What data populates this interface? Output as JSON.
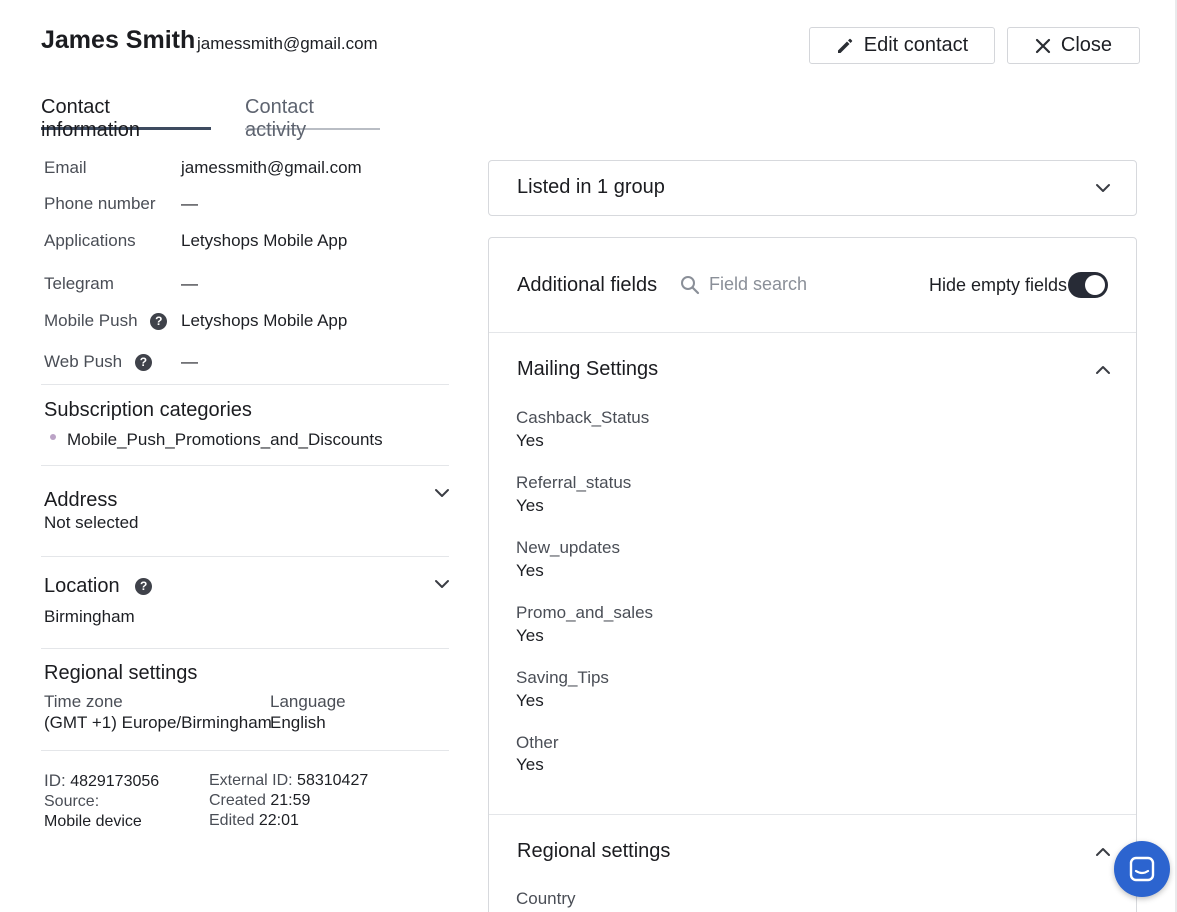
{
  "header": {
    "name": "James Smith",
    "email": "jamessmith@gmail.com",
    "edit_label": "Edit contact",
    "close_label": "Close"
  },
  "tabs": [
    {
      "label": "Contact information",
      "active": true
    },
    {
      "label": "Contact activity",
      "active": false
    }
  ],
  "contact": {
    "email_label": "Email",
    "email_value": "jamessmith@gmail.com",
    "phone_label": "Phone number",
    "phone_value": "—",
    "apps_label": "Applications",
    "apps_value": "Letyshops Mobile App",
    "telegram_label": "Telegram",
    "telegram_value": "—",
    "mobile_push_label": "Mobile Push",
    "mobile_push_value": "Letyshops Mobile App",
    "web_push_label": "Web Push",
    "web_push_value": "—"
  },
  "subscriptions": {
    "title": "Subscription categories",
    "items": [
      "Mobile_Push_Promotions_and_Discounts"
    ]
  },
  "address": {
    "title": "Address",
    "value": "Not selected"
  },
  "location": {
    "title": "Location",
    "value": "Birmingham"
  },
  "regional": {
    "title": "Regional settings",
    "timezone_label": "Time zone",
    "timezone_value": "(GMT +1) Europe/Birmingham",
    "language_label": "Language",
    "language_value": "English"
  },
  "meta": {
    "id_label": "ID:",
    "id_value": "4829173056",
    "source_label": "Source:",
    "source_value": "Mobile device",
    "external_label": "External ID:",
    "external_value": "58310427",
    "created_label": "Created",
    "created_value": "21:59",
    "edited_label": "Edited",
    "edited_value": "22:01"
  },
  "right": {
    "group_title": "Listed in 1 group",
    "additional_title": "Additional fields",
    "search_placeholder": "Field search",
    "hide_empty_label": "Hide empty fields",
    "hide_empty_on": true,
    "mailing_title": "Mailing Settings",
    "mailing_fields": [
      {
        "label": "Cashback_Status",
        "value": "Yes"
      },
      {
        "label": "Referral_status",
        "value": "Yes"
      },
      {
        "label": "New_updates",
        "value": "Yes"
      },
      {
        "label": "Promo_and_sales",
        "value": "Yes"
      },
      {
        "label": "Saving_Tips",
        "value": "Yes"
      },
      {
        "label": "Other",
        "value": "Yes"
      }
    ],
    "regional_title": "Regional settings",
    "country_label": "Country"
  },
  "icons": {
    "edit": "pencil-icon",
    "close": "close-icon",
    "help": "question-circle-icon",
    "chevron_down": "chevron-down-icon",
    "chevron_up": "chevron-up-icon",
    "search": "search-icon",
    "chat": "chat-icon"
  },
  "colors": {
    "toggle_on": "#272b36",
    "chat_button": "#2c64cf",
    "bullet": "#bba3c6",
    "active_tab": "#3e4b60"
  }
}
